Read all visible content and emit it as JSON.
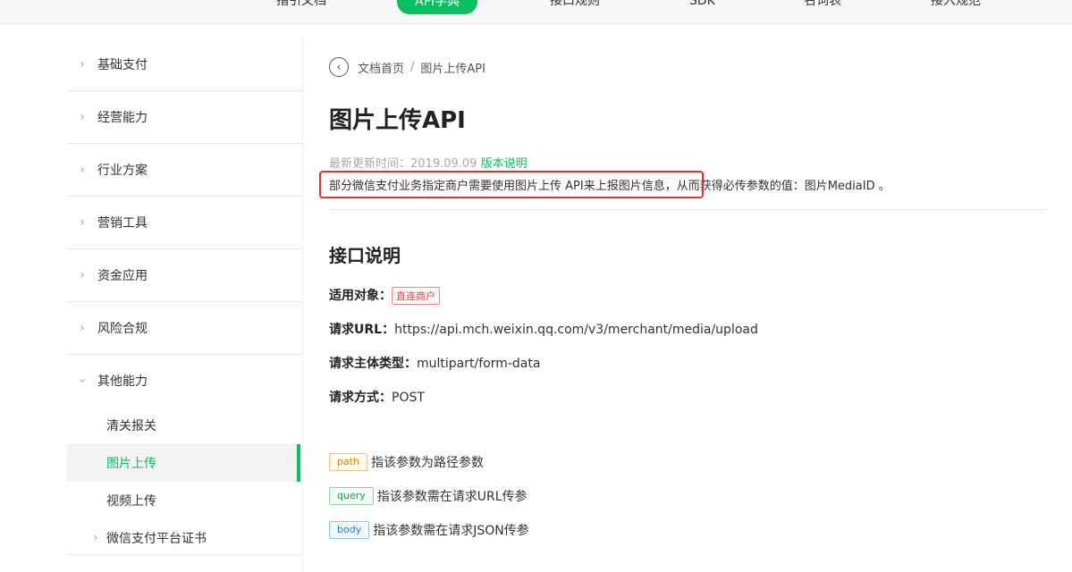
{
  "topnav": {
    "tabs": [
      {
        "label": "指引文档"
      },
      {
        "label": "API字典"
      },
      {
        "label": "接口规则"
      },
      {
        "label": "SDK"
      },
      {
        "label": "名词表"
      },
      {
        "label": "接入规范"
      }
    ]
  },
  "sidebar": {
    "items": [
      {
        "label": "基础支付"
      },
      {
        "label": "经营能力"
      },
      {
        "label": "行业方案"
      },
      {
        "label": "营销工具"
      },
      {
        "label": "资金应用"
      },
      {
        "label": "风险合规"
      },
      {
        "label": "其他能力"
      }
    ],
    "sub_items": [
      {
        "label": "清关报关"
      },
      {
        "label": "图片上传"
      },
      {
        "label": "视频上传"
      },
      {
        "label": "微信支付平台证书"
      }
    ],
    "active_color": "#07c160"
  },
  "breadcrumb": {
    "home": "文档首页",
    "separator": "/",
    "current": "图片上传API"
  },
  "page": {
    "title": "图片上传API",
    "updated_label": "最新更新时间：2019.09.09",
    "version_link": "版本说明",
    "description": "部分微信支付业务指定商户需要使用图片上传 API来上报图片信息，从而获得必传参数的值：图片MediaID 。"
  },
  "interface": {
    "heading": "接口说明",
    "target_label": "适用对象：",
    "target_tag": "直连商户",
    "url_label": "请求URL：",
    "url_value": "https://api.mch.weixin.qq.com/v3/merchant/media/upload",
    "content_type_label": "请求主体类型：",
    "content_type_value": "multipart/form-data",
    "method_label": "请求方式：",
    "method_value": "POST"
  },
  "params": [
    {
      "chip": "path",
      "text": "指该参数为路径参数"
    },
    {
      "chip": "query",
      "text": "指该参数需在请求URL传参"
    },
    {
      "chip": "body",
      "text": "指该参数需在请求JSON传参"
    }
  ]
}
